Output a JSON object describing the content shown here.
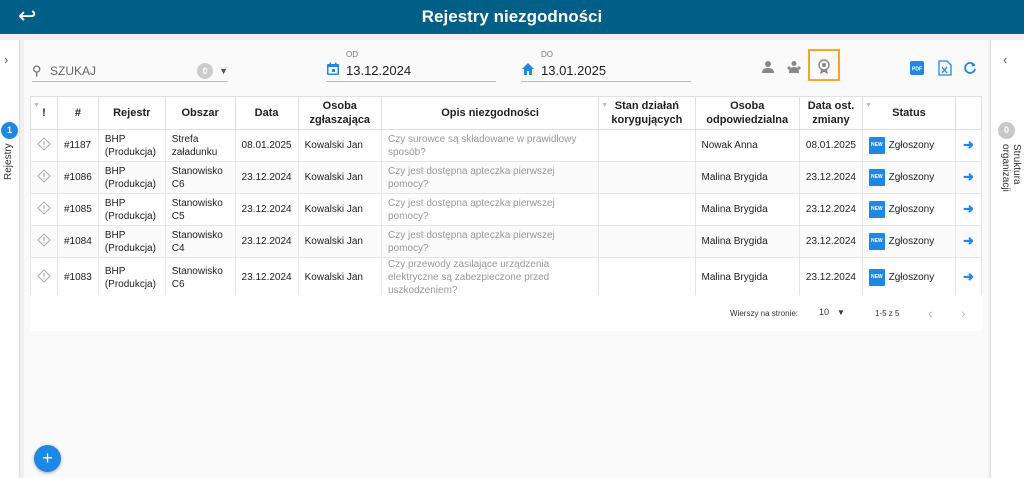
{
  "header": {
    "title": "Rejestry niezgodności",
    "back_icon": "arrow-left-icon"
  },
  "left_rail": {
    "badge": "1",
    "label": "Rejestry"
  },
  "right_rail": {
    "badge": "0",
    "label": "Struktura organizacji"
  },
  "toolbar": {
    "search_placeholder": "SZUKAJ",
    "search_count": "0",
    "date_from": {
      "label": "OD",
      "value": "13.12.2024"
    },
    "date_to": {
      "label": "DO",
      "value": "13.01.2025"
    }
  },
  "colors": {
    "header": "#005f87",
    "accent": "#1e88e5",
    "highlight": "#f5a623",
    "pdf": "#1e88e5",
    "excel": "#1e88e5"
  },
  "table": {
    "headers": {
      "flag": "!",
      "num": "#",
      "register": "Rejestr",
      "area": "Obszar",
      "date": "Data",
      "reporter": "Osoba zgłaszająca",
      "description": "Opis niezgodności",
      "corrective": "Stan działań korygujących",
      "responsible": "Osoba odpowiedzialna",
      "last_change": "Data ost. zmiany",
      "status": "Status"
    },
    "rows": [
      {
        "num": "#1187",
        "register": "BHP (Produkcja)",
        "area": "Strefa załadunku",
        "date": "08.01.2025",
        "reporter": "Kowalski Jan",
        "description": "Czy surowce są składowane w prawidłowy sposób?",
        "corrective": "",
        "responsible": "Nowak Anna",
        "last_change": "08.01.2025",
        "status": "Zgłoszony"
      },
      {
        "num": "#1086",
        "register": "BHP (Produkcja)",
        "area": "Stanowisko C6",
        "date": "23.12.2024",
        "reporter": "Kowalski Jan",
        "description": "Czy jest dostępna apteczka pierwszej pomocy?",
        "corrective": "",
        "responsible": "Malina Brygida",
        "last_change": "23.12.2024",
        "status": "Zgłoszony"
      },
      {
        "num": "#1085",
        "register": "BHP (Produkcja)",
        "area": "Stanowisko C5",
        "date": "23.12.2024",
        "reporter": "Kowalski Jan",
        "description": "Czy jest dostępna apteczka pierwszej pomocy?",
        "corrective": "",
        "responsible": "Malina Brygida",
        "last_change": "23.12.2024",
        "status": "Zgłoszony"
      },
      {
        "num": "#1084",
        "register": "BHP (Produkcja)",
        "area": "Stanowisko C4",
        "date": "23.12.2024",
        "reporter": "Kowalski Jan",
        "description": "Czy jest dostępna apteczka pierwszej pomocy?",
        "corrective": "",
        "responsible": "Malina Brygida",
        "last_change": "23.12.2024",
        "status": "Zgłoszony"
      },
      {
        "num": "#1083",
        "register": "BHP (Produkcja)",
        "area": "Stanowisko C6",
        "date": "23.12.2024",
        "reporter": "Kowalski Jan",
        "description": "Czy przewody zasilające urządzenia elektryczne są zabezpieczone przed uszkodzeniem?",
        "corrective": "",
        "responsible": "Malina Brygida",
        "last_change": "23.12.2024",
        "status": "Zgłoszony"
      }
    ],
    "status_tag": "NEW"
  },
  "pagination": {
    "rows_per_page_label": "Wierszy na stronie:",
    "rows_per_page": "10",
    "range": "1-5 z 5"
  }
}
